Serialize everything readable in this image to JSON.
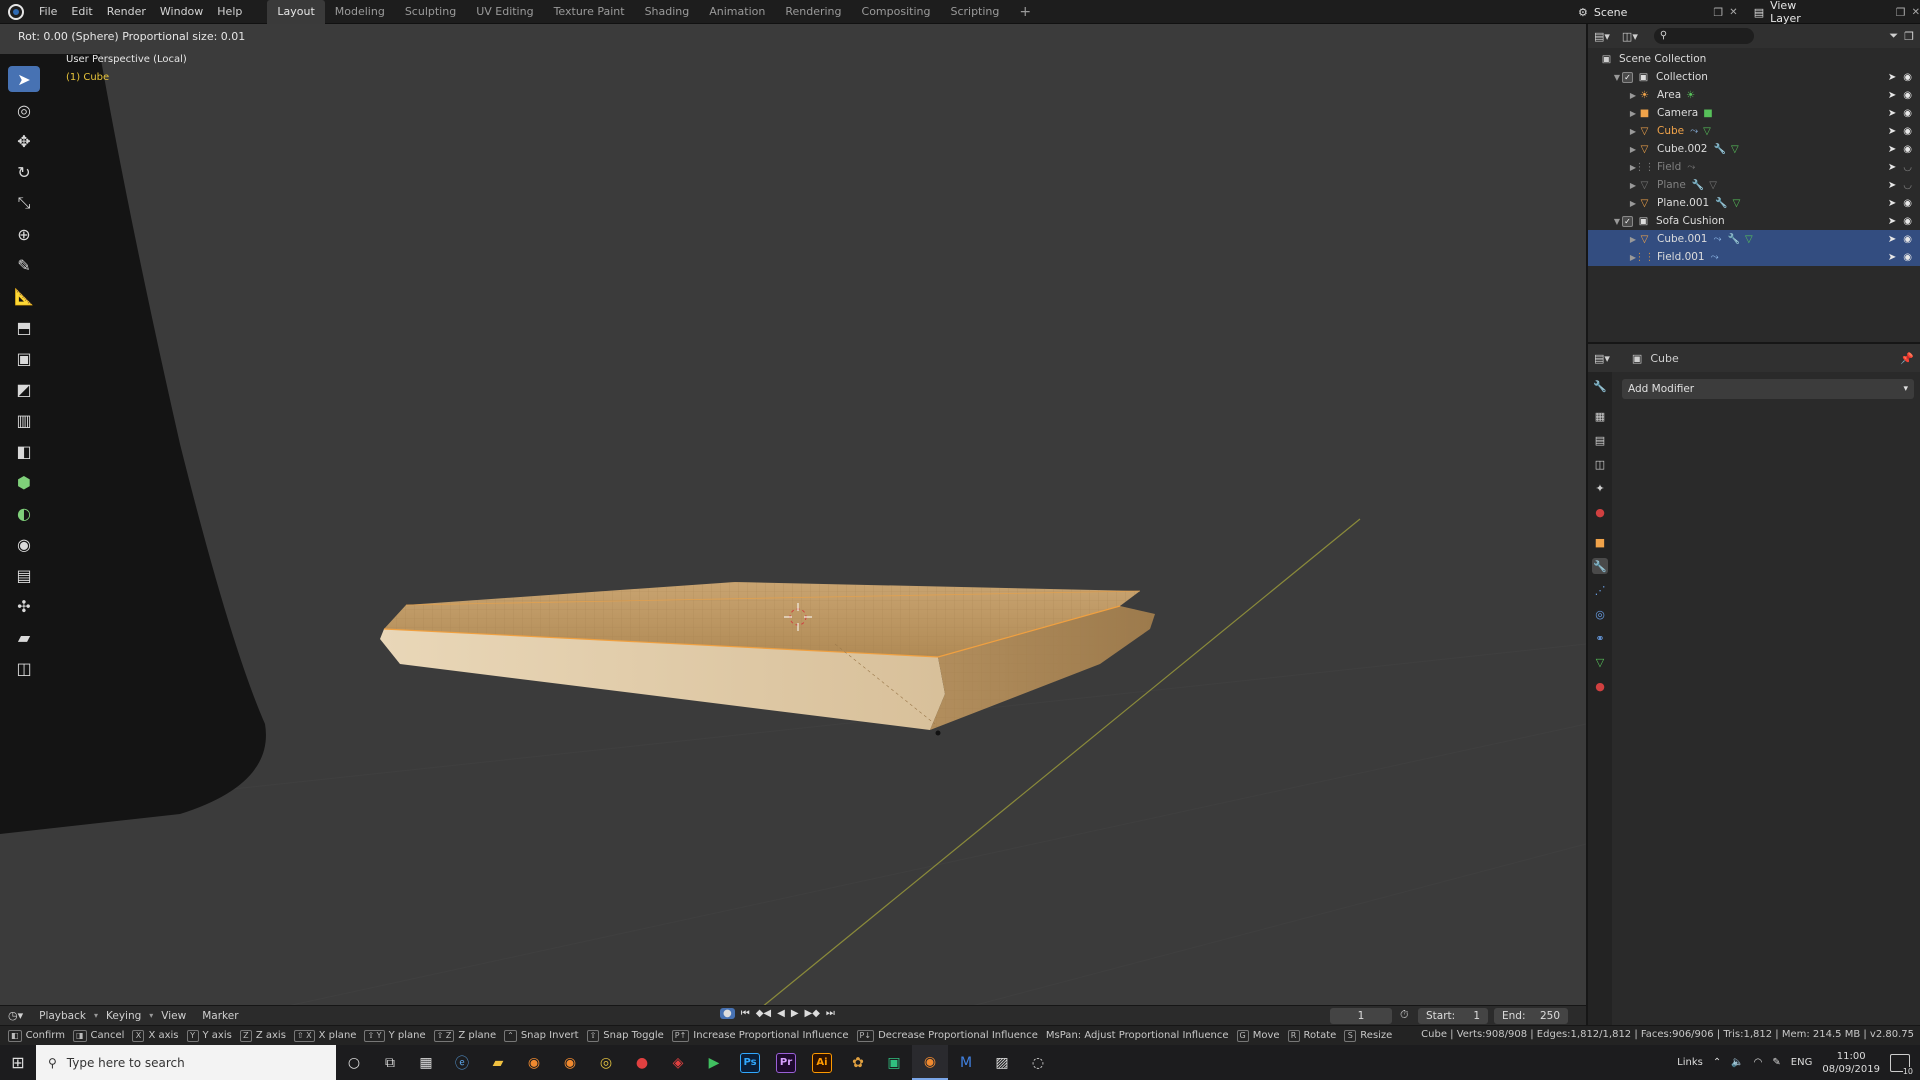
{
  "menubar": {
    "items": [
      "File",
      "Edit",
      "Render",
      "Window",
      "Help"
    ],
    "workspaces": [
      "Layout",
      "Modeling",
      "Sculpting",
      "UV Editing",
      "Texture Paint",
      "Shading",
      "Animation",
      "Rendering",
      "Compositing",
      "Scripting"
    ],
    "active_workspace": "Layout",
    "add_tab": "+",
    "scene_label": "Scene",
    "view_layer_label": "View Layer"
  },
  "viewport": {
    "header_status": "Rot: 0.00 (Sphere) Proportional size: 0.01",
    "view_name": "User Perspective (Local)",
    "object_name": "(1) Cube",
    "tools": [
      "select-box",
      "cursor",
      "move",
      "rotate",
      "scale",
      "transform",
      "annotate",
      "measure",
      "extrude",
      "inset",
      "bevel",
      "loop-cut",
      "knife",
      "poly-build",
      "spin",
      "smooth",
      "edge-slide",
      "shrink-fatten",
      "shear",
      "rip"
    ]
  },
  "outliner": {
    "root": "Scene Collection",
    "rows": [
      {
        "label": "Collection",
        "type": "collection",
        "level": 1,
        "expanded": true
      },
      {
        "label": "Area",
        "type": "light",
        "level": 2
      },
      {
        "label": "Camera",
        "type": "camera",
        "level": 2
      },
      {
        "label": "Cube",
        "type": "mesh",
        "level": 2,
        "active": true
      },
      {
        "label": "Cube.002",
        "type": "mesh",
        "level": 2
      },
      {
        "label": "Field",
        "type": "field",
        "level": 2,
        "dim": true
      },
      {
        "label": "Plane",
        "type": "mesh",
        "level": 2,
        "dim": true
      },
      {
        "label": "Plane.001",
        "type": "mesh",
        "level": 2
      },
      {
        "label": "Sofa Cushion",
        "type": "collection",
        "level": 1,
        "expanded": true
      },
      {
        "label": "Cube.001",
        "type": "mesh",
        "level": 2,
        "selected": true
      },
      {
        "label": "Field.001",
        "type": "field",
        "level": 2,
        "selected": true
      }
    ]
  },
  "properties": {
    "object": "Cube",
    "add_modifier": "Add Modifier",
    "tabs": [
      "tool",
      "render",
      "output",
      "view-layer",
      "scene",
      "world",
      "object",
      "modifiers",
      "particles",
      "physics",
      "constraints",
      "data",
      "material"
    ],
    "active_tab": "modifiers"
  },
  "timeline": {
    "menus": [
      "Playback",
      "Keying",
      "View",
      "Marker"
    ],
    "current_frame": "1",
    "start_label": "Start:",
    "start_value": "1",
    "end_label": "End:",
    "end_value": "250"
  },
  "statusbar": {
    "items": [
      {
        "key": "",
        "label": "Confirm"
      },
      {
        "key": "",
        "label": "Cancel"
      },
      {
        "key": "X",
        "label": "X axis"
      },
      {
        "key": "Y",
        "label": "Y axis"
      },
      {
        "key": "Z",
        "label": "Z axis"
      },
      {
        "key": "⇧ X",
        "label": "X plane"
      },
      {
        "key": "⇧ Y",
        "label": "Y plane"
      },
      {
        "key": "⇧ Z",
        "label": "Z plane"
      },
      {
        "key": "⌃",
        "label": "Snap Invert"
      },
      {
        "key": "⇧",
        "label": "Snap Toggle"
      },
      {
        "key": "P↑",
        "label": "Increase Proportional Influence"
      },
      {
        "key": "P↓",
        "label": "Decrease Proportional Influence"
      },
      {
        "key": "",
        "label": "MsPan: Adjust Proportional Influence"
      },
      {
        "key": "G",
        "label": "Move"
      },
      {
        "key": "R",
        "label": "Rotate"
      },
      {
        "key": "S",
        "label": "Resize"
      }
    ],
    "stats": "Cube | Verts:908/908 | Edges:1,812/1,812 | Faces:906/906 | Tris:1,812 | Mem: 214.5 MB | v2.80.75"
  },
  "taskbar": {
    "search_placeholder": "Type here to search",
    "apps": [
      "cortana",
      "task-view",
      "calculator",
      "edge",
      "file-explorer",
      "blender-alt",
      "blender-alt-2",
      "chrome",
      "app-red",
      "app-red-2",
      "play",
      "photoshop",
      "premiere",
      "illustrator",
      "app-colorful",
      "app-green",
      "blender",
      "app-blue",
      "photos",
      "app-circle"
    ],
    "app_labels": {
      "photoshop": "Ps",
      "premiere": "Pr",
      "illustrator": "Ai"
    },
    "tray_links": "Links",
    "language": "ENG",
    "time": "11:00",
    "date": "08/09/2019",
    "notifications": "10"
  }
}
